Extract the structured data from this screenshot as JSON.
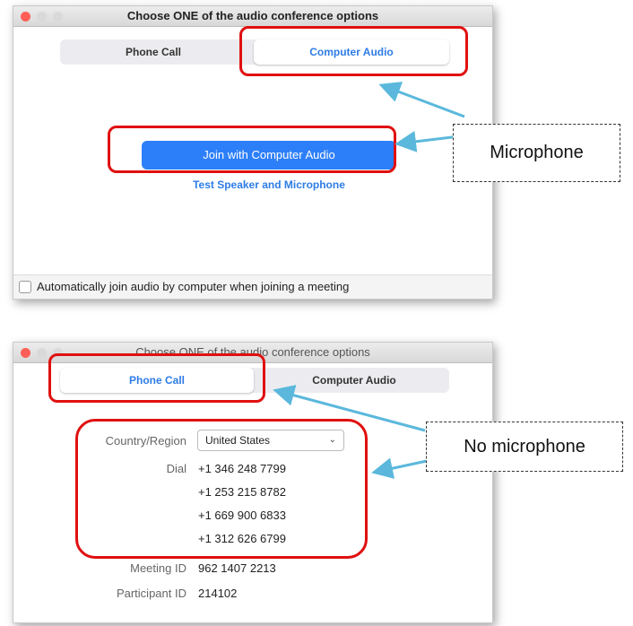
{
  "dialog1": {
    "title": "Choose ONE of the audio conference options",
    "tabs": [
      {
        "label": "Phone Call",
        "selected": false
      },
      {
        "label": "Computer Audio",
        "selected": true
      }
    ],
    "join_button": "Join with Computer Audio",
    "test_link": "Test Speaker and Microphone",
    "auto_join_label": "Automatically join audio by computer when joining a meeting"
  },
  "dialog2": {
    "title": "Choose ONE of the audio conference options",
    "tabs": [
      {
        "label": "Phone Call",
        "selected": true
      },
      {
        "label": "Computer Audio",
        "selected": false
      }
    ],
    "country_label": "Country/Region",
    "country_value": "United States",
    "dial_label": "Dial",
    "dial_numbers": [
      "+1 346 248 7799",
      "+1 253 215 8782",
      "+1 669 900 6833",
      "+1 312 626 6799"
    ],
    "meeting_id_label": "Meeting ID",
    "meeting_id": "962 1407 2213",
    "participant_id_label": "Participant ID",
    "participant_id": "214102"
  },
  "callouts": {
    "microphone": "Microphone",
    "no_microphone": "No microphone"
  },
  "colors": {
    "highlight": "#e01010",
    "arrow": "#5bb8dc",
    "accent_blue": "#2d7ff9"
  }
}
